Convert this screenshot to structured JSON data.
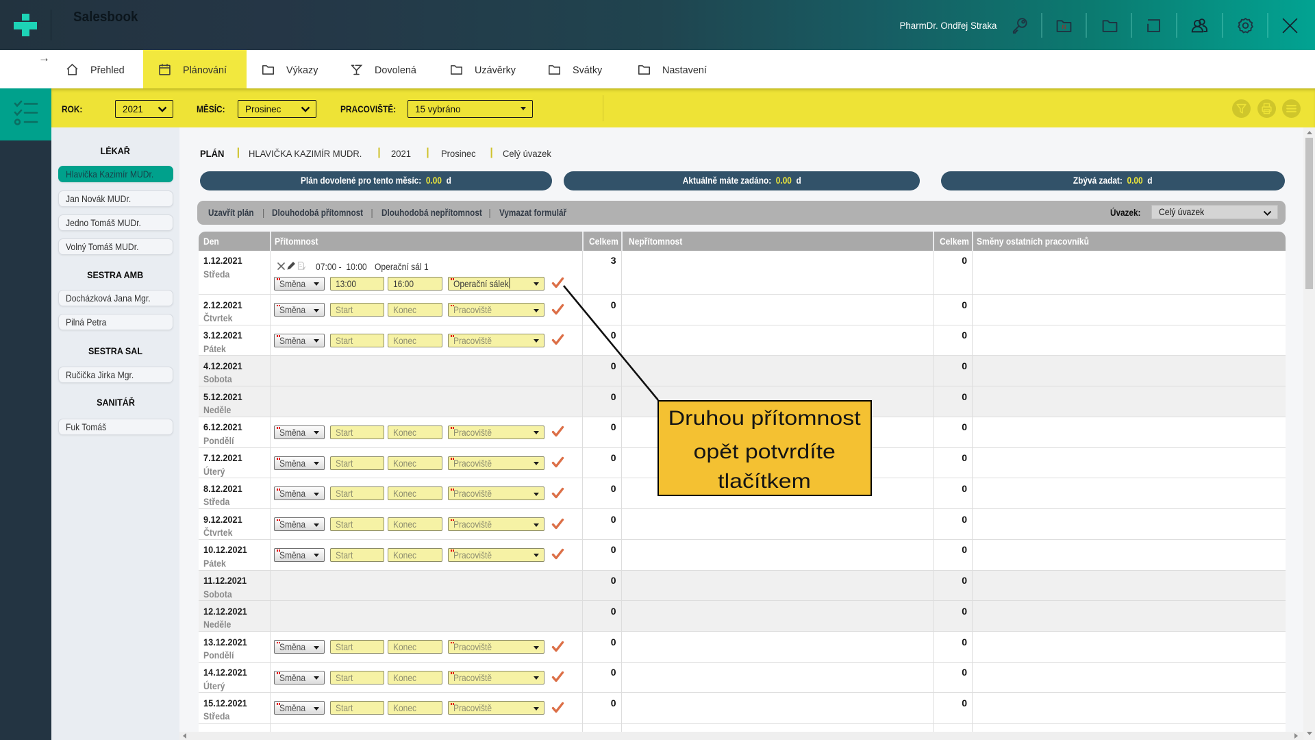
{
  "app": {
    "title": "Salesbook",
    "user_name": "PharmDr. Ondřej Straka"
  },
  "header": {
    "icons": [
      {
        "name": "key-icon"
      },
      {
        "name": "folder-n-icon"
      },
      {
        "name": "folder-icon"
      },
      {
        "name": "square-icon"
      },
      {
        "name": "users-icon"
      },
      {
        "name": "gear-icon"
      },
      {
        "name": "close-icon"
      }
    ]
  },
  "nav": {
    "back_arrow": "→",
    "tabs": [
      {
        "label": "Přehled",
        "icon": "home-icon",
        "active": false
      },
      {
        "label": "Plánování",
        "icon": "calendar-icon",
        "active": true
      },
      {
        "label": "Výkazy",
        "icon": "folder-icon",
        "active": false
      },
      {
        "label": "Dovolená",
        "icon": "glass-icon",
        "active": false
      },
      {
        "label": "Uzávěrky",
        "icon": "folder-icon",
        "active": false
      },
      {
        "label": "Svátky",
        "icon": "folder-icon",
        "active": false
      },
      {
        "label": "Nastavení",
        "icon": "folder-icon",
        "active": false
      }
    ]
  },
  "filterbar": {
    "fields": [
      {
        "label": "ROK:",
        "value": "2021",
        "arrow": "chevron"
      },
      {
        "label": "MĚSÍC:",
        "value": "Prosinec",
        "arrow": "chevron"
      },
      {
        "label": "PRACOVIŠTĚ:",
        "value": "15 vybráno",
        "arrow": "triangle"
      }
    ],
    "actions": [
      {
        "name": "funnel-icon"
      },
      {
        "name": "printer-icon"
      },
      {
        "name": "menu-icon"
      }
    ]
  },
  "sidebar": {
    "groups": [
      {
        "title": "LÉKAŘ",
        "items": [
          {
            "label": "Hlavička Kazimír MUDr.",
            "selected": true
          },
          {
            "label": "Jan Novák MUDr.",
            "selected": false
          },
          {
            "label": "Jedno Tomáš MUDr.",
            "selected": false
          },
          {
            "label": "Volný Tomáš MUDr.",
            "selected": false
          }
        ]
      },
      {
        "title": "SESTRA AMB",
        "items": [
          {
            "label": "Docházková Jana Mgr.",
            "selected": false
          },
          {
            "label": "Pilná Petra",
            "selected": false
          }
        ]
      },
      {
        "title": "SESTRA SAL",
        "items": [
          {
            "label": "Ručička Jirka Mgr.",
            "selected": false
          }
        ]
      },
      {
        "title": "SANITÁŘ",
        "items": [
          {
            "label": "Fuk Tomáš",
            "selected": false
          }
        ]
      }
    ]
  },
  "breadcrumb": [
    "PLÁN",
    "HLAVIČKA KAZIMÍR MUDR.",
    "2021",
    "Prosinec",
    "Celý úvazek"
  ],
  "pills": [
    {
      "label": "Plán dovolené pro tento měsíc:",
      "value": "0.00",
      "unit": "d"
    },
    {
      "label": "Aktuálně máte zadáno:",
      "value": "0.00",
      "unit": "d"
    },
    {
      "label": "Zbývá zadat:",
      "value": "0.00",
      "unit": "d"
    }
  ],
  "toolbar": {
    "actions": [
      "Uzavřít plán",
      "Dlouhodobá přítomnost",
      "Dlouhodobá nepřítomnost",
      "Vymazat formulář"
    ],
    "uvazek_label": "Úvazek:",
    "uvazek_value": "Celý úvazek"
  },
  "table": {
    "columns": [
      "Den",
      "Přítomnost",
      "Celkem",
      "Nepřítomnost",
      "Celkem",
      "Směny ostatních pracovníků"
    ],
    "placeholders": {
      "shift": "Směna",
      "start": "Start",
      "end": "Konec",
      "workplace": "Pracoviště"
    },
    "rows": [
      {
        "date": "1.12.2021",
        "day": "Středa",
        "weekend": false,
        "total1": "3",
        "total2": "0",
        "entry": {
          "time": "07:00 -  10:00",
          "place": "Operační sál 1"
        },
        "values": {
          "start": "13:00",
          "end": "16:00",
          "workplace": "Operační sálek",
          "focused": true
        }
      },
      {
        "date": "2.12.2021",
        "day": "Čtvrtek",
        "weekend": false,
        "total1": "0",
        "total2": "0"
      },
      {
        "date": "3.12.2021",
        "day": "Pátek",
        "weekend": false,
        "total1": "0",
        "total2": "0"
      },
      {
        "date": "4.12.2021",
        "day": "Sobota",
        "weekend": true,
        "total1": "0",
        "total2": "0"
      },
      {
        "date": "5.12.2021",
        "day": "Neděle",
        "weekend": true,
        "total1": "0",
        "total2": "0"
      },
      {
        "date": "6.12.2021",
        "day": "Pondělí",
        "weekend": false,
        "total1": "0",
        "total2": "0"
      },
      {
        "date": "7.12.2021",
        "day": "Úterý",
        "weekend": false,
        "total1": "0",
        "total2": "0"
      },
      {
        "date": "8.12.2021",
        "day": "Středa",
        "weekend": false,
        "total1": "0",
        "total2": "0"
      },
      {
        "date": "9.12.2021",
        "day": "Čtvrtek",
        "weekend": false,
        "total1": "0",
        "total2": "0"
      },
      {
        "date": "10.12.2021",
        "day": "Pátek",
        "weekend": false,
        "total1": "0",
        "total2": "0"
      },
      {
        "date": "11.12.2021",
        "day": "Sobota",
        "weekend": true,
        "total1": "0",
        "total2": "0"
      },
      {
        "date": "12.12.2021",
        "day": "Neděle",
        "weekend": true,
        "total1": "0",
        "total2": "0"
      },
      {
        "date": "13.12.2021",
        "day": "Pondělí",
        "weekend": false,
        "total1": "0",
        "total2": "0"
      },
      {
        "date": "14.12.2021",
        "day": "Úterý",
        "weekend": false,
        "total1": "0",
        "total2": "0"
      },
      {
        "date": "15.12.2021",
        "day": "Středa",
        "weekend": false,
        "total1": "0",
        "total2": "0"
      }
    ]
  },
  "callout": {
    "lines": [
      "Druhou přítomnost",
      "opět potvrdíte",
      "tlačítkem"
    ]
  },
  "colors": {
    "header_left": "#263845",
    "header_right": "#02a592",
    "logo": "#1dd3b6",
    "yellow_bar": "#eee336",
    "active_tab": "#f2e83e",
    "teal_box": "#00a18c",
    "strip": "#233442",
    "sidebar": "#e9edf2",
    "selected_item": "#00a18c",
    "pill": "#325269",
    "pill_value": "#e9e43b",
    "toolbar": "#b1b1b1",
    "table_header": "#a9a9a9",
    "weekend_row": "#f0f0f0",
    "input_yellow": "#f6f2a5",
    "check_orange": "#dc6f47",
    "callout_fill": "#f4c132"
  }
}
